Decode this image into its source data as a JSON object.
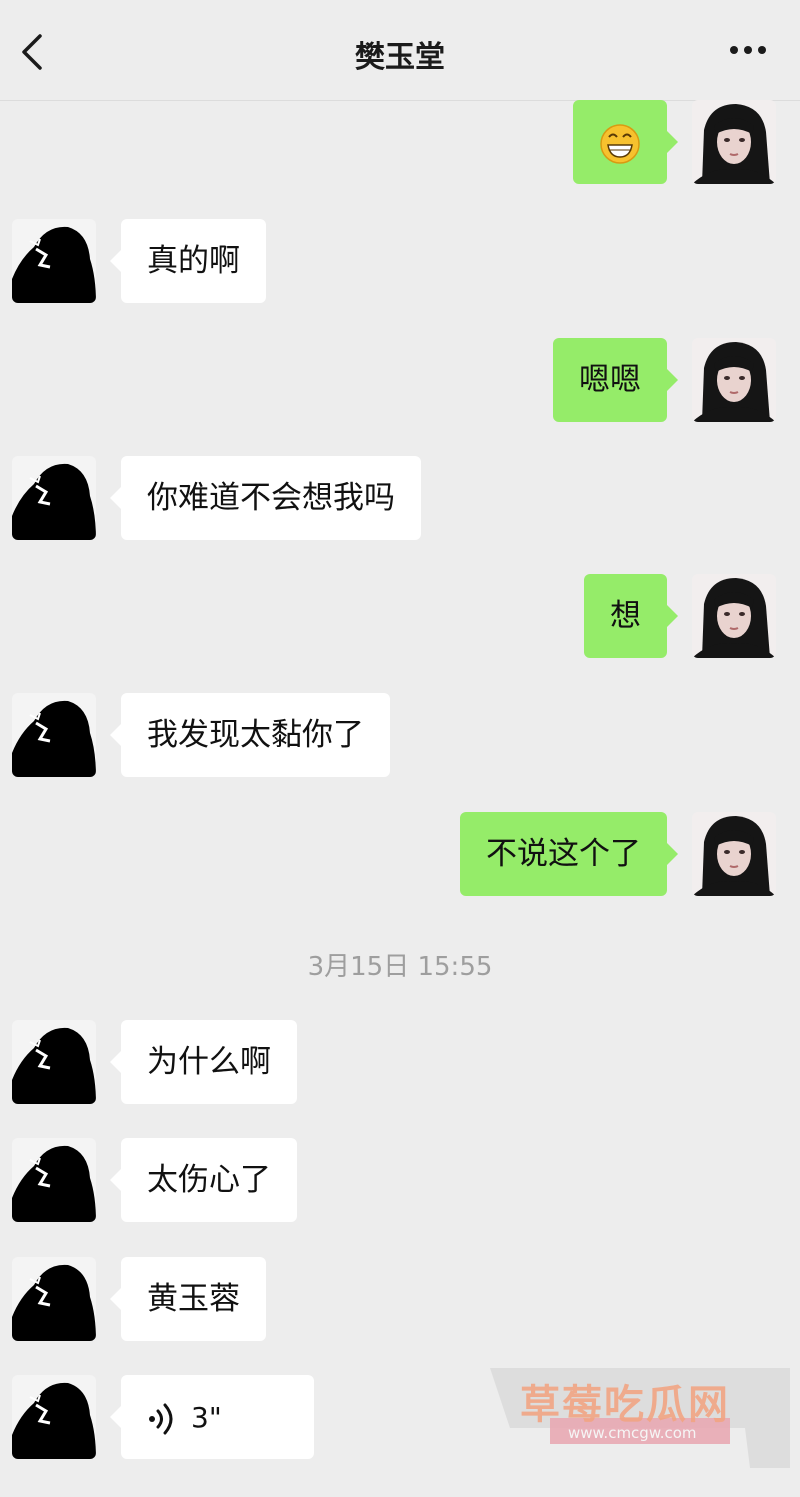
{
  "header": {
    "title": "樊玉堂",
    "back_icon": "chevron-left-icon",
    "more_icon": "more-dots-icon"
  },
  "messages": [
    {
      "side": "out",
      "type": "emoji",
      "emoji": "grinning-face-icon"
    },
    {
      "side": "in",
      "text": "真的啊"
    },
    {
      "side": "out",
      "text": "嗯嗯"
    },
    {
      "side": "in",
      "text": "你难道不会想我吗"
    },
    {
      "side": "out",
      "text": "想"
    },
    {
      "side": "in",
      "text": "我发现太黏你了"
    },
    {
      "side": "out",
      "text": "不说这个了"
    },
    {
      "side": "in",
      "text": "为什么啊"
    },
    {
      "side": "in",
      "text": "太伤心了"
    },
    {
      "side": "in",
      "text": "黄玉蓉"
    },
    {
      "side": "in",
      "type": "voice",
      "duration": "3\""
    }
  ],
  "timestamp": "3月15日 15:55",
  "watermark": {
    "text": "草莓吃瓜网",
    "url": "www.cmcgw.com"
  },
  "colors": {
    "background": "#ededed",
    "outgoing_bubble": "#95ec69",
    "incoming_bubble": "#ffffff"
  }
}
